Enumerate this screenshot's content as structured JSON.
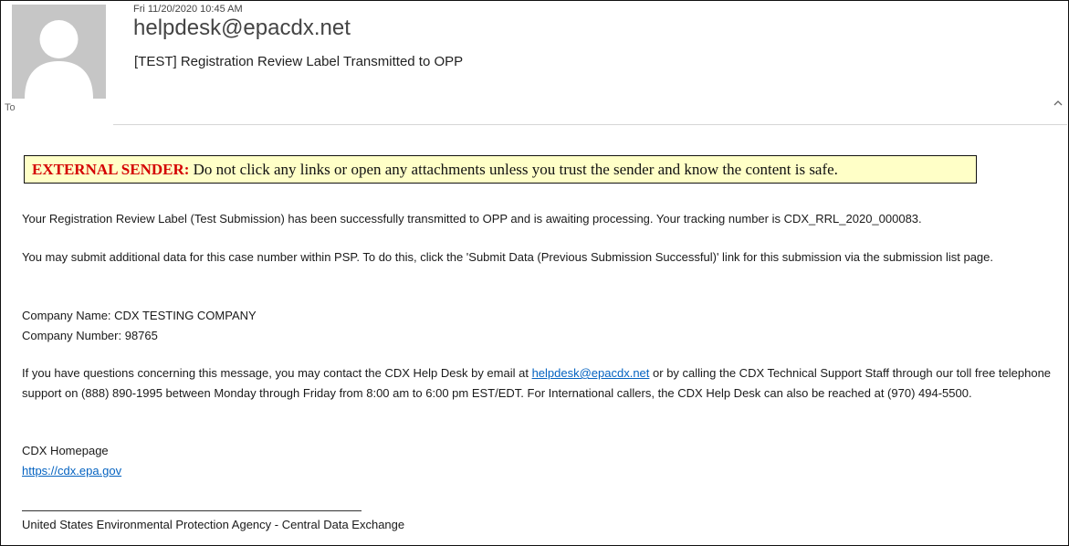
{
  "header": {
    "date": "Fri 11/20/2020 10:45 AM",
    "sender": "helpdesk@epacdx.net",
    "subject": "[TEST] Registration Review Label Transmitted to OPP",
    "to_label": "To"
  },
  "banner": {
    "prefix": "EXTERNAL SENDER:",
    "text": " Do not click any links or open any attachments unless you trust the sender and know the content is safe."
  },
  "body": {
    "p1": "Your Registration Review Label (Test Submission) has been successfully transmitted to OPP and is awaiting processing. Your tracking number is CDX_RRL_2020_000083.",
    "p2": "You may submit additional data for this case number within PSP. To do this, click the 'Submit Data (Previous Submission Successful)' link for this submission via the submission list page.",
    "company_name": "Company Name: CDX TESTING COMPANY",
    "company_number": "Company Number: 98765",
    "p4_before": "If you have questions concerning this message, you may contact the CDX Help Desk by email at ",
    "p4_link": "helpdesk@epacdx.net",
    "p4_after": " or by calling the CDX Technical Support Staff through our toll free telephone support on (888) 890-1995 between Monday through Friday from 8:00 am to 6:00 pm EST/EDT. For International callers, the CDX Help Desk can also be reached at (970) 494-5500.",
    "homepage_label": "CDX Homepage",
    "homepage_link": "https://cdx.epa.gov",
    "footer": "United States Environmental Protection Agency - Central Data Exchange"
  },
  "colors": {
    "banner_bg": "#ffffc7",
    "external_red": "#d40000",
    "link": "#0563c1"
  }
}
